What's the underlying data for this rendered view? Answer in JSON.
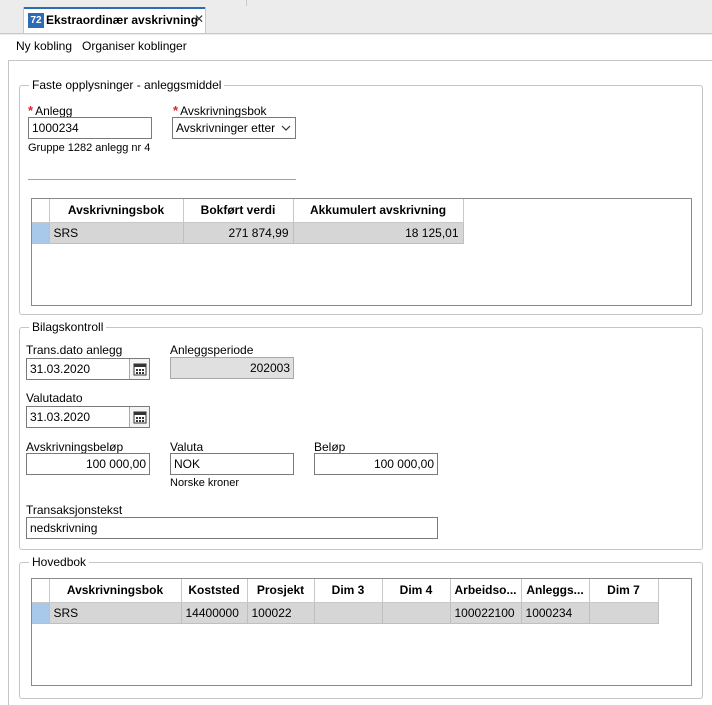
{
  "tab": {
    "badge": "72",
    "title": "Ekstraordinær avskrivning",
    "close": "✕"
  },
  "toolbar": {
    "new_link": "Ny kobling",
    "organize_links": "Organiser koblinger"
  },
  "fixed": {
    "legend": "Faste opplysninger - anleggsmiddel",
    "anlegg_label": "Anlegg",
    "anlegg_value": "1000234",
    "anlegg_desc": "Gruppe 1282 anlegg nr 4",
    "book_label": "Avskrivningsbok",
    "book_value": "Avskrivninger etter",
    "grid": {
      "columns": [
        "Avskrivningsbok",
        "Bokført verdi",
        "Akkumulert avskrivning"
      ],
      "rows": [
        [
          "SRS",
          "271 874,99",
          "18 125,01"
        ]
      ]
    }
  },
  "voucher": {
    "legend": "Bilagskontroll",
    "trans_date_label": "Trans.dato anlegg",
    "trans_date_value": "31.03.2020",
    "period_label": "Anleggsperiode",
    "period_value": "202003",
    "value_date_label": "Valutadato",
    "value_date_value": "31.03.2020",
    "amount_label": "Avskrivningsbeløp",
    "amount_value": "100 000,00",
    "currency_label": "Valuta",
    "currency_value": "NOK",
    "currency_desc": "Norske kroner",
    "sum_label": "Beløp",
    "sum_value": "100 000,00",
    "text_label": "Transaksjonstekst",
    "text_value": "nedskrivning"
  },
  "ledger": {
    "legend": "Hovedbok",
    "grid": {
      "columns": [
        "Avskrivningsbok",
        "Koststed",
        "Prosjekt",
        "Dim 3",
        "Dim 4",
        "Arbeidso...",
        "Anleggs...",
        "Dim 7"
      ],
      "rows": [
        [
          "SRS",
          "14400000",
          "100022",
          "",
          "",
          "100022100",
          "1000234",
          ""
        ]
      ]
    }
  },
  "icons": {
    "calendar": "calendar-icon",
    "dropdown": "chevron-down-icon",
    "required": "required-asterisk-icon"
  },
  "colors": {
    "accent": "#2b6cb4",
    "required": "#d6262a",
    "row_selector": "#a9c9ea",
    "row_bg": "#d6d6d6"
  }
}
